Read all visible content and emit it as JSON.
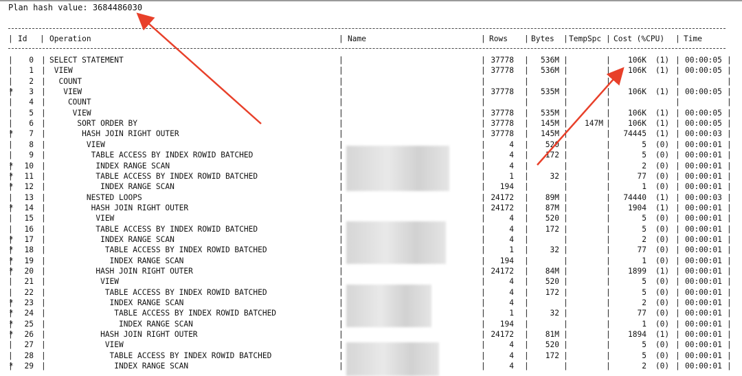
{
  "plan_hash_label": "Plan hash value: 3684486030",
  "columns": {
    "id": "Id",
    "operation": "Operation",
    "name": "Name",
    "rows": "Rows",
    "bytes": "Bytes",
    "tempspc": "TempSpc",
    "cost": "Cost (%CPU)",
    "time": "Time"
  },
  "rows": [
    {
      "star": "",
      "id": "0",
      "op": "SELECT STATEMENT",
      "rows": "37778",
      "bytes": "536M",
      "temp": "",
      "cost": "106K",
      "cpu": "(1)",
      "time": "00:00:05"
    },
    {
      "star": "",
      "id": "1",
      "op": " VIEW",
      "rows": "37778",
      "bytes": "536M",
      "temp": "",
      "cost": "106K",
      "cpu": "(1)",
      "time": "00:00:05"
    },
    {
      "star": "",
      "id": "2",
      "op": "  COUNT",
      "rows": "",
      "bytes": "",
      "temp": "",
      "cost": "",
      "cpu": "",
      "time": ""
    },
    {
      "star": "*",
      "id": "3",
      "op": "   VIEW",
      "rows": "37778",
      "bytes": "535M",
      "temp": "",
      "cost": "106K",
      "cpu": "(1)",
      "time": "00:00:05"
    },
    {
      "star": "",
      "id": "4",
      "op": "    COUNT",
      "rows": "",
      "bytes": "",
      "temp": "",
      "cost": "",
      "cpu": "",
      "time": ""
    },
    {
      "star": "",
      "id": "5",
      "op": "     VIEW",
      "rows": "37778",
      "bytes": "535M",
      "temp": "",
      "cost": "106K",
      "cpu": "(1)",
      "time": "00:00:05"
    },
    {
      "star": "",
      "id": "6",
      "op": "      SORT ORDER BY",
      "rows": "37778",
      "bytes": "145M",
      "temp": "147M",
      "cost": "106K",
      "cpu": "(1)",
      "time": "00:00:05"
    },
    {
      "star": "*",
      "id": "7",
      "op": "       HASH JOIN RIGHT OUTER",
      "rows": "37778",
      "bytes": "145M",
      "temp": "",
      "cost": "74445",
      "cpu": "(1)",
      "time": "00:00:03"
    },
    {
      "star": "",
      "id": "8",
      "op": "        VIEW",
      "rows": "4",
      "bytes": "520",
      "temp": "",
      "cost": "5",
      "cpu": "(0)",
      "time": "00:00:01"
    },
    {
      "star": "",
      "id": "9",
      "op": "         TABLE ACCESS BY INDEX ROWID BATCHED",
      "rows": "4",
      "bytes": "172",
      "temp": "",
      "cost": "5",
      "cpu": "(0)",
      "time": "00:00:01"
    },
    {
      "star": "*",
      "id": "10",
      "op": "          INDEX RANGE SCAN",
      "rows": "4",
      "bytes": "",
      "temp": "",
      "cost": "2",
      "cpu": "(0)",
      "time": "00:00:01"
    },
    {
      "star": "*",
      "id": "11",
      "op": "          TABLE ACCESS BY INDEX ROWID BATCHED",
      "rows": "1",
      "bytes": "32",
      "temp": "",
      "cost": "77",
      "cpu": "(0)",
      "time": "00:00:01"
    },
    {
      "star": "*",
      "id": "12",
      "op": "           INDEX RANGE SCAN",
      "rows": "194",
      "bytes": "",
      "temp": "",
      "cost": "1",
      "cpu": "(0)",
      "time": "00:00:01"
    },
    {
      "star": "",
      "id": "13",
      "op": "        NESTED LOOPS",
      "rows": "24172",
      "bytes": "89M",
      "temp": "",
      "cost": "74440",
      "cpu": "(1)",
      "time": "00:00:03"
    },
    {
      "star": "*",
      "id": "14",
      "op": "         HASH JOIN RIGHT OUTER",
      "rows": "24172",
      "bytes": "87M",
      "temp": "",
      "cost": "1904",
      "cpu": "(1)",
      "time": "00:00:01"
    },
    {
      "star": "",
      "id": "15",
      "op": "          VIEW",
      "rows": "4",
      "bytes": "520",
      "temp": "",
      "cost": "5",
      "cpu": "(0)",
      "time": "00:00:01"
    },
    {
      "star": "",
      "id": "16",
      "op": "          TABLE ACCESS BY INDEX ROWID BATCHED",
      "rows": "4",
      "bytes": "172",
      "temp": "",
      "cost": "5",
      "cpu": "(0)",
      "time": "00:00:01"
    },
    {
      "star": "*",
      "id": "17",
      "op": "           INDEX RANGE SCAN",
      "rows": "4",
      "bytes": "",
      "temp": "",
      "cost": "2",
      "cpu": "(0)",
      "time": "00:00:01"
    },
    {
      "star": "*",
      "id": "18",
      "op": "            TABLE ACCESS BY INDEX ROWID BATCHED",
      "rows": "1",
      "bytes": "32",
      "temp": "",
      "cost": "77",
      "cpu": "(0)",
      "time": "00:00:01"
    },
    {
      "star": "*",
      "id": "19",
      "op": "             INDEX RANGE SCAN",
      "rows": "194",
      "bytes": "",
      "temp": "",
      "cost": "1",
      "cpu": "(0)",
      "time": "00:00:01"
    },
    {
      "star": "*",
      "id": "20",
      "op": "          HASH JOIN RIGHT OUTER",
      "rows": "24172",
      "bytes": "84M",
      "temp": "",
      "cost": "1899",
      "cpu": "(1)",
      "time": "00:00:01"
    },
    {
      "star": "",
      "id": "21",
      "op": "           VIEW",
      "rows": "4",
      "bytes": "520",
      "temp": "",
      "cost": "5",
      "cpu": "(0)",
      "time": "00:00:01"
    },
    {
      "star": "",
      "id": "22",
      "op": "            TABLE ACCESS BY INDEX ROWID BATCHED",
      "rows": "4",
      "bytes": "172",
      "temp": "",
      "cost": "5",
      "cpu": "(0)",
      "time": "00:00:01"
    },
    {
      "star": "*",
      "id": "23",
      "op": "             INDEX RANGE SCAN",
      "rows": "4",
      "bytes": "",
      "temp": "",
      "cost": "2",
      "cpu": "(0)",
      "time": "00:00:01"
    },
    {
      "star": "*",
      "id": "24",
      "op": "              TABLE ACCESS BY INDEX ROWID BATCHED",
      "rows": "1",
      "bytes": "32",
      "temp": "",
      "cost": "77",
      "cpu": "(0)",
      "time": "00:00:01"
    },
    {
      "star": "*",
      "id": "25",
      "op": "               INDEX RANGE SCAN",
      "rows": "194",
      "bytes": "",
      "temp": "",
      "cost": "1",
      "cpu": "(0)",
      "time": "00:00:01"
    },
    {
      "star": "*",
      "id": "26",
      "op": "           HASH JOIN RIGHT OUTER",
      "rows": "24172",
      "bytes": "81M",
      "temp": "",
      "cost": "1894",
      "cpu": "(1)",
      "time": "00:00:01"
    },
    {
      "star": "",
      "id": "27",
      "op": "            VIEW",
      "rows": "4",
      "bytes": "520",
      "temp": "",
      "cost": "5",
      "cpu": "(0)",
      "time": "00:00:01"
    },
    {
      "star": "",
      "id": "28",
      "op": "             TABLE ACCESS BY INDEX ROWID BATCHED",
      "rows": "4",
      "bytes": "172",
      "temp": "",
      "cost": "5",
      "cpu": "(0)",
      "time": "00:00:01"
    },
    {
      "star": "*",
      "id": "29",
      "op": "              INDEX RANGE SCAN",
      "rows": "4",
      "bytes": "",
      "temp": "",
      "cost": "2",
      "cpu": "(0)",
      "time": "00:00:01"
    }
  ],
  "colors": {
    "arrow": "#e8402a",
    "text": "#111111",
    "redaction": "#d6d6d6"
  }
}
